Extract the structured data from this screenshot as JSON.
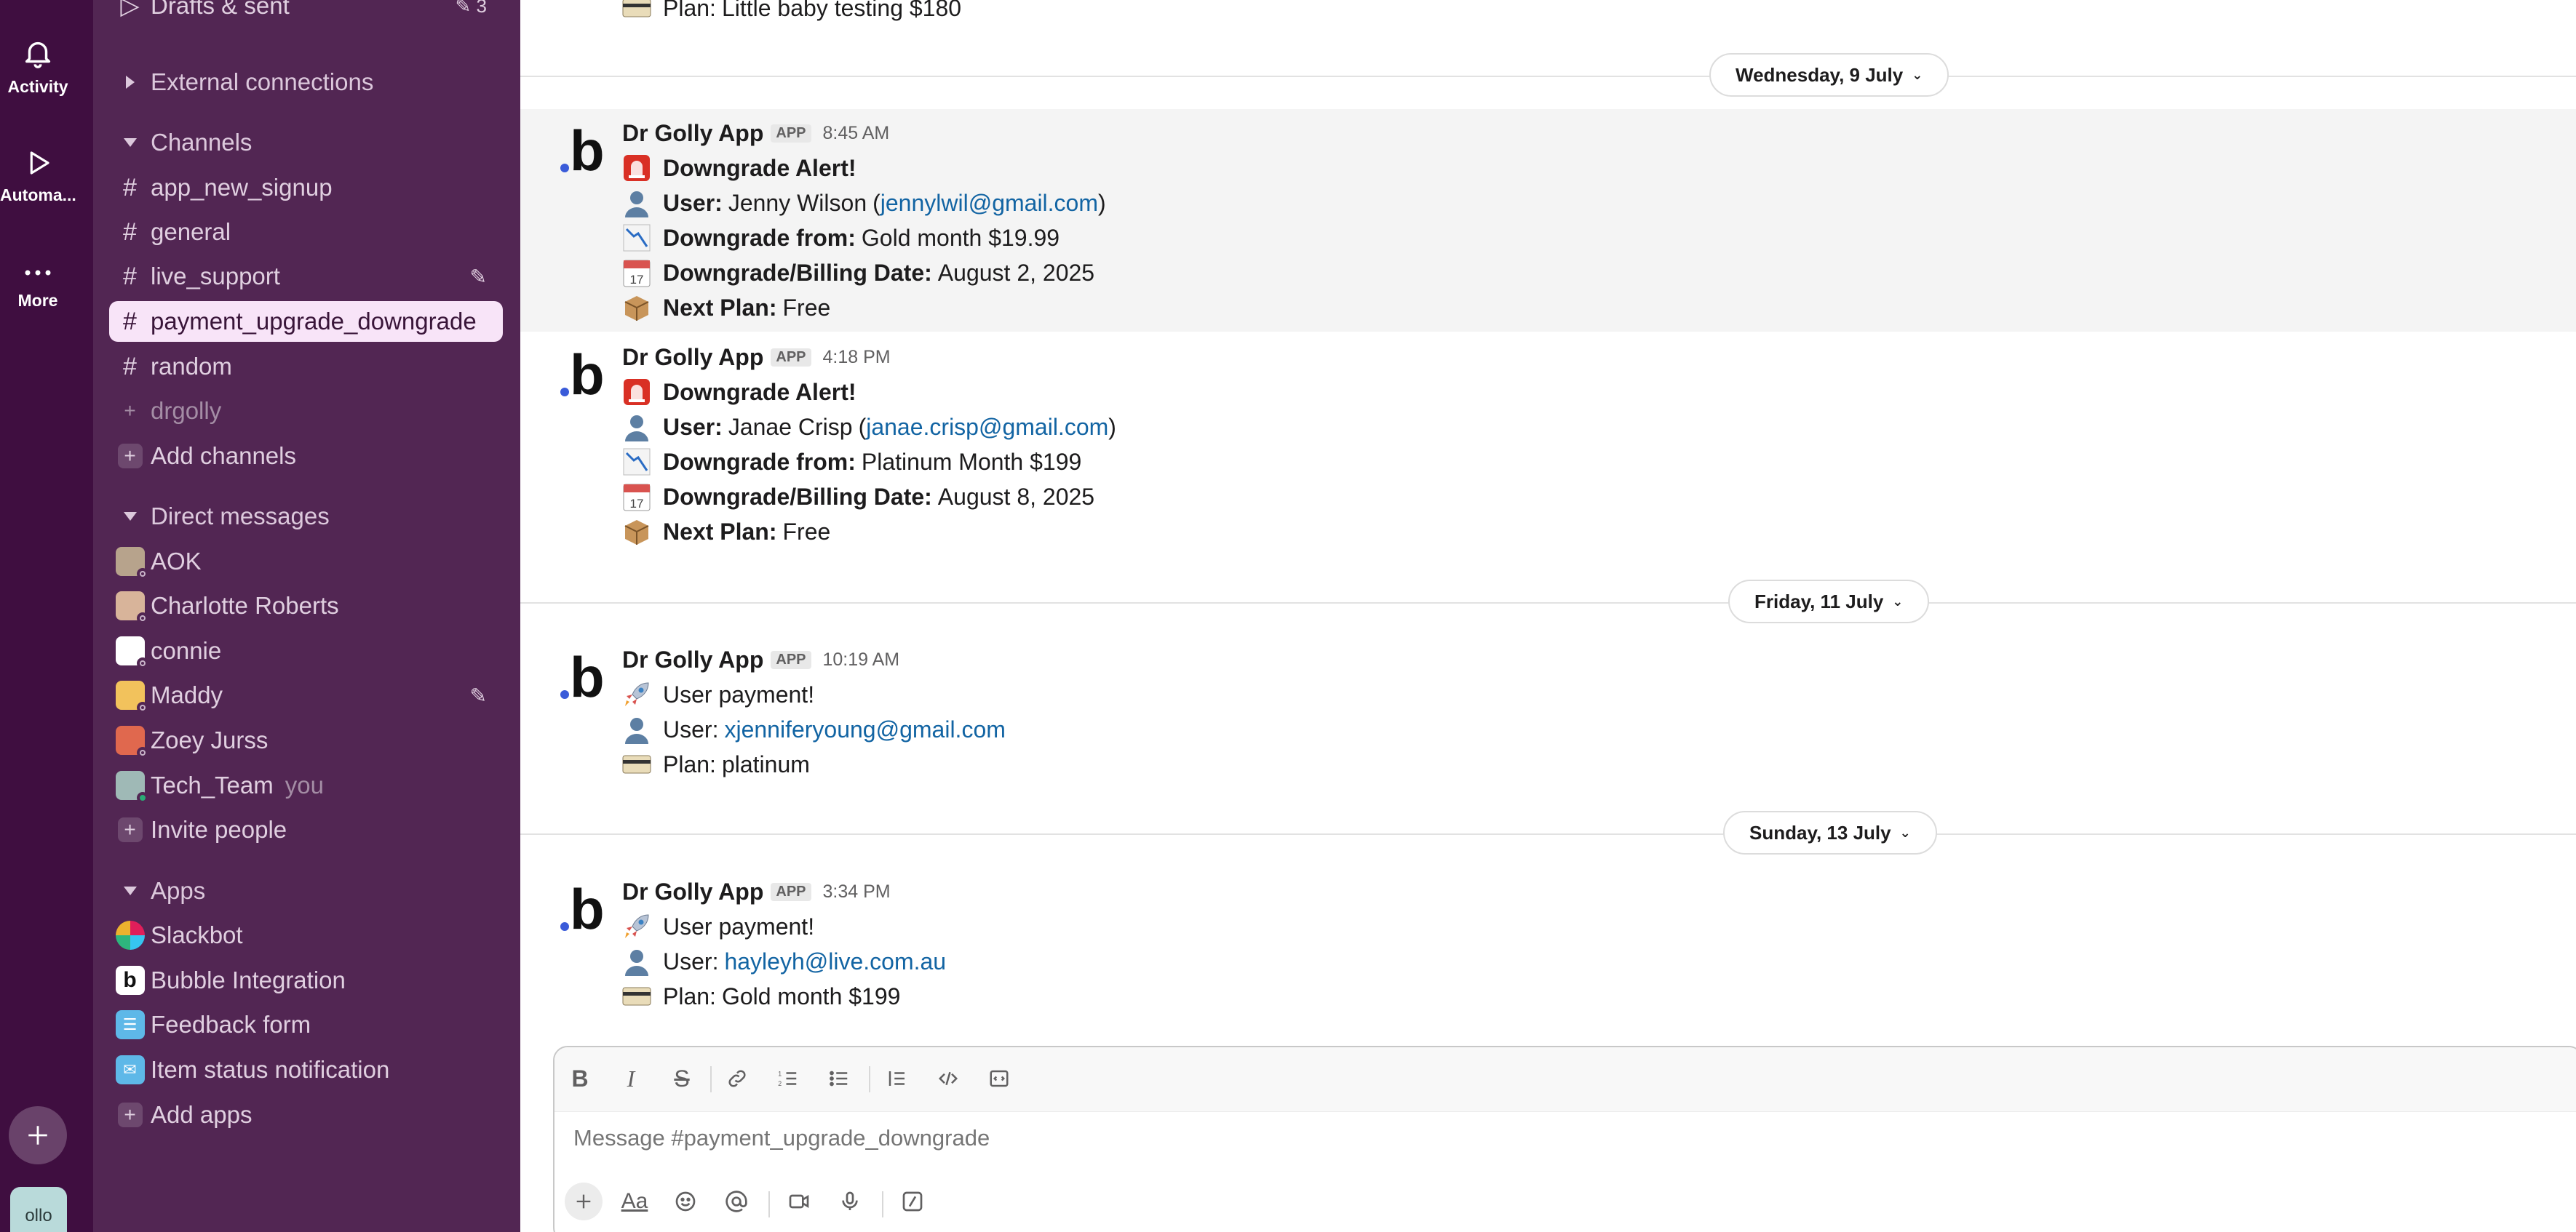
{
  "rail": {
    "items": [
      {
        "label": "Activity",
        "icon": "bell-icon"
      },
      {
        "label": "Automa...",
        "icon": "play-icon"
      },
      {
        "label": "More",
        "icon": "more-icon"
      }
    ],
    "workspace_avatar_text": "ollo"
  },
  "sidebar": {
    "drafts": {
      "label": "Drafts & sent",
      "count": "3"
    },
    "external_connections": "External connections",
    "channels_header": "Channels",
    "channels": [
      {
        "name": "app_new_signup"
      },
      {
        "name": "general"
      },
      {
        "name": "live_support"
      },
      {
        "name": "payment_upgrade_downgrade"
      },
      {
        "name": "random"
      },
      {
        "name": "drgolly"
      }
    ],
    "add_channels": "Add channels",
    "dm_header": "Direct messages",
    "dms": [
      {
        "name": "AOK",
        "avatar_color": "#b7a38c"
      },
      {
        "name": "Charlotte Roberts",
        "avatar_color": "#d8b49a"
      },
      {
        "name": "connie",
        "avatar_color": "#ffffff"
      },
      {
        "name": "Maddy",
        "avatar_color": "#f2c25c"
      },
      {
        "name": "Zoey Jurss",
        "avatar_color": "#e0684e"
      },
      {
        "name": "Tech_Team",
        "avatar_color": "#9fb9b6",
        "you": "you"
      }
    ],
    "invite_people": "Invite people",
    "apps_header": "Apps",
    "apps": [
      {
        "name": "Slackbot",
        "icon": "slackbot-icon"
      },
      {
        "name": "Bubble Integration",
        "icon": "bubble-icon"
      },
      {
        "name": "Feedback form",
        "icon": "form-icon"
      },
      {
        "name": "Item status notification",
        "icon": "notification-icon"
      }
    ],
    "add_apps": "Add apps"
  },
  "main": {
    "top_partial": {
      "label": "Plan:",
      "value": "Little baby testing $180"
    },
    "day_dividers": [
      "Wednesday, 9 July",
      "Friday, 11 July",
      "Sunday, 13 July"
    ],
    "messages": [
      {
        "sender": "Dr Golly App",
        "badge": "APP",
        "time": "8:45 AM",
        "title": "Downgrade Alert!",
        "user_label": "User:",
        "user_name": "Jenny Wilson",
        "user_email": "jennylwil@gmail.com",
        "from_label": "Downgrade from:",
        "from_value": "Gold month $19.99",
        "date_label": "Downgrade/Billing Date:",
        "date_value": "August 2, 2025",
        "next_label": "Next Plan:",
        "next_value": "Free",
        "calendar_day": "17"
      },
      {
        "sender": "Dr Golly App",
        "badge": "APP",
        "time": "4:18 PM",
        "title": "Downgrade Alert!",
        "user_label": "User:",
        "user_name": "Janae Crisp",
        "user_email": "janae.crisp@gmail.com",
        "from_label": "Downgrade from:",
        "from_value": "Platinum Month $199",
        "date_label": "Downgrade/Billing Date:",
        "date_value": "August 8, 2025",
        "next_label": "Next Plan:",
        "next_value": "Free",
        "calendar_day": "17"
      },
      {
        "sender": "Dr Golly App",
        "badge": "APP",
        "time": "10:19 AM",
        "title": "User payment!",
        "user_label": "User:",
        "user_email": "xjenniferyoung@gmail.com",
        "plan_label": "Plan:",
        "plan_value": "platinum"
      },
      {
        "sender": "Dr Golly App",
        "badge": "APP",
        "time": "3:34 PM",
        "title": "User payment!",
        "user_label": "User:",
        "user_email": "hayleyh@live.com.au",
        "plan_label": "Plan:",
        "plan_value": "Gold month $199"
      }
    ]
  },
  "composer": {
    "placeholder": "Message #payment_upgrade_downgrade",
    "format_label": "Aa"
  },
  "colors": {
    "rail_bg": "#3f0e40",
    "sidebar_bg": "#522653",
    "active_item_bg": "#f8e4f8",
    "link": "#1264a3"
  }
}
